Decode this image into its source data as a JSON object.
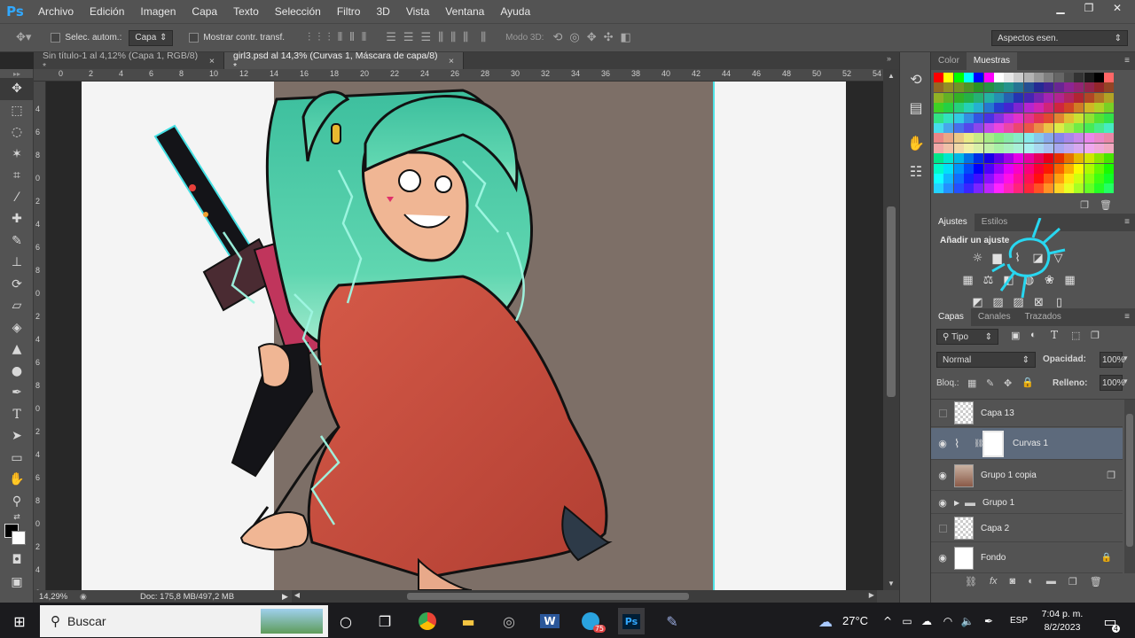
{
  "menubar": {
    "logo": "Ps",
    "items": [
      "Archivo",
      "Edición",
      "Imagen",
      "Capa",
      "Texto",
      "Selección",
      "Filtro",
      "3D",
      "Vista",
      "Ventana",
      "Ayuda"
    ]
  },
  "options": {
    "auto_select_label": "Selec. autom.:",
    "auto_select_value": "Capa",
    "transform_label": "Mostrar contr. transf.",
    "mode3d_label": "Modo 3D:",
    "workspace": "Aspectos esen."
  },
  "tabs": [
    {
      "label": "Sin título-1 al 4,12% (Capa 1, RGB/8) *",
      "active": false
    },
    {
      "label": "girl3.psd al 14,3% (Curvas 1, Máscara de capa/8) *",
      "active": true
    }
  ],
  "ruler": {
    "h_labels": [
      "0",
      "2",
      "4",
      "6",
      "8",
      "10",
      "12",
      "14",
      "16",
      "18",
      "20",
      "22",
      "24",
      "26",
      "28",
      "30",
      "32",
      "34",
      "36",
      "38",
      "40",
      "42",
      "44",
      "46",
      "48",
      "50",
      "52",
      "54",
      "56"
    ],
    "v_labels": [
      "4",
      "6",
      "8",
      "0",
      "2",
      "4",
      "6",
      "8",
      "0",
      "2",
      "4",
      "6",
      "8",
      "0",
      "2",
      "4",
      "6",
      "8",
      "0",
      "2",
      "4",
      "6"
    ]
  },
  "status": {
    "zoom": "14,29%",
    "doc": "Doc: 175,8 MB/497,2 MB"
  },
  "swatches_panel": {
    "tabs": [
      "Color",
      "Muestras"
    ],
    "active": "Muestras"
  },
  "adjustments_panel": {
    "tabs": [
      "Ajustes",
      "Estilos"
    ],
    "heading": "Añadir un ajuste"
  },
  "layers_panel": {
    "tabs": [
      "Capas",
      "Canales",
      "Trazados"
    ],
    "filter": "Tipo",
    "blend_mode": "Normal",
    "opacity_label": "Opacidad:",
    "opacity": "100%",
    "lock_label": "Bloq.:",
    "fill_label": "Relleno:",
    "fill": "100%",
    "layers": [
      {
        "name": "Capa 13",
        "visible": false,
        "thumb": "check",
        "active": false
      },
      {
        "name": "Curvas 1",
        "visible": true,
        "thumb": "curves",
        "active": true
      },
      {
        "name": "Grupo 1 copia",
        "visible": true,
        "thumb": "art",
        "active": false
      },
      {
        "name": "Grupo 1",
        "visible": true,
        "thumb": "folder",
        "active": false
      },
      {
        "name": "Capa 2",
        "visible": false,
        "thumb": "sketch",
        "active": false
      },
      {
        "name": "Fondo",
        "visible": true,
        "thumb": "white",
        "active": false
      }
    ]
  },
  "taskbar": {
    "search": "Buscar",
    "temperature": "27°C",
    "language": "ESP",
    "time": "7:04 p. m.",
    "date": "8/2/2023",
    "badge_count": "75",
    "notif_count": "4"
  },
  "colors": {
    "ui_dark": "#535353",
    "selected_layer": "#5d6a7c",
    "ps_blue": "#31a8ff",
    "hair": "#4cc9a6",
    "hoodie": "#c24a3c"
  }
}
